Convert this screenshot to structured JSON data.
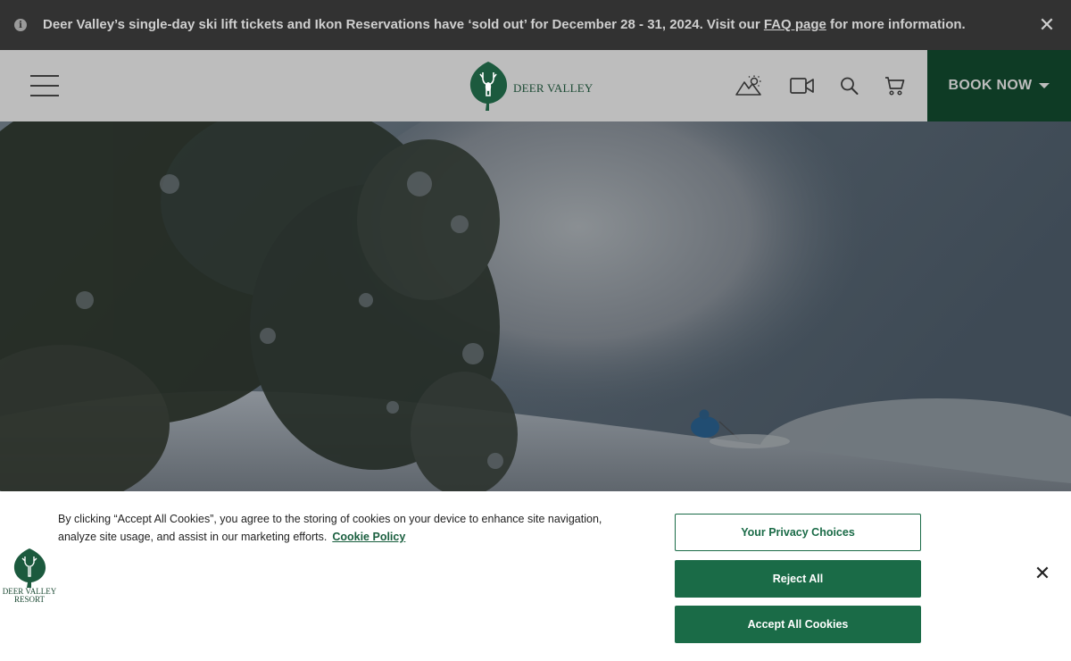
{
  "alert": {
    "text_before": "Deer Valley’s single-day ski lift tickets and Ikon Reservations have ‘sold out’ for December 28 - 31, 2024. Visit our ",
    "link": "FAQ page",
    "text_after": " for more information.",
    "info_icon": "info-icon",
    "close_icon": "close-icon"
  },
  "header": {
    "logo_text": "DEER VALLEY",
    "icons": [
      "menu-icon",
      "weather-icon",
      "video-icon",
      "search-icon",
      "cart-icon"
    ],
    "book_now": "BOOK NOW",
    "colors": {
      "header_bg": "#bdbdbd",
      "book_bg": "#0e3b25"
    }
  },
  "cookie": {
    "message": "By clicking “Accept All Cookies”, you agree to the storing of cookies on your device to enhance site navigation, analyze site usage, and assist in our marketing efforts.",
    "policy_link": "Cookie Policy",
    "privacy_button": "Your Privacy Choices",
    "reject_button": "Reject All",
    "accept_button": "Accept All Cookies",
    "logo_line1": "DEER VALLEY",
    "logo_line2": "RESORT",
    "colors": {
      "brand_green": "#1a6b47"
    }
  }
}
